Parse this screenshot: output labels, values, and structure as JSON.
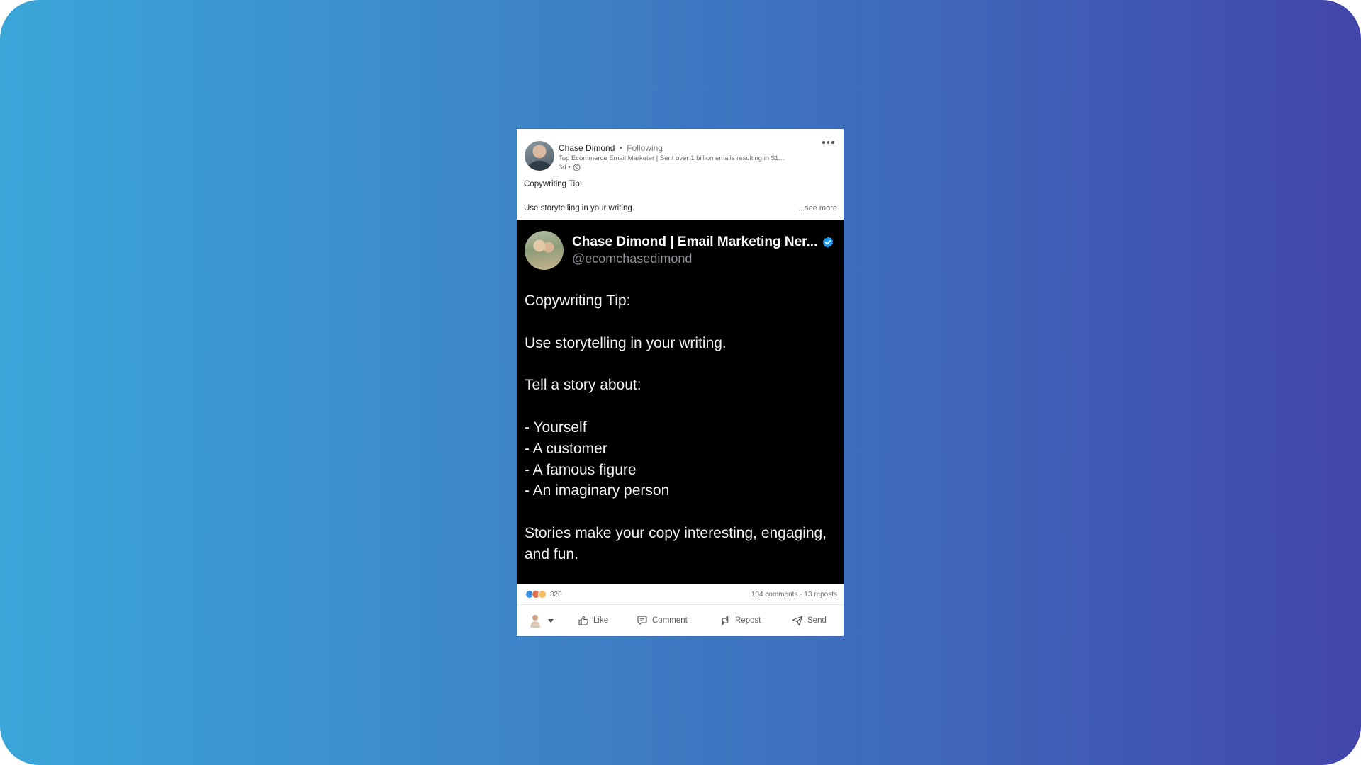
{
  "post": {
    "author_name": "Chase Dimond",
    "separator": "•",
    "follow_status": "Following",
    "headline": "Top Ecommerce Email Marketer | Sent over 1 billion emails resulting in $1...",
    "time": "3d •",
    "body_line1": "Copywriting Tip:",
    "body_line2": "Use storytelling in your writing.",
    "see_more": "...see more"
  },
  "tweet": {
    "name": "Chase Dimond | Email Marketing Ner...",
    "handle": "@ecomchasedimond",
    "lines": [
      "Copywriting Tip:",
      "Use storytelling in your writing.",
      "Tell a story about:",
      "- Yourself",
      "- A customer",
      "- A famous figure",
      "- An imaginary person",
      "Stories make your copy interesting, engaging,",
      "and fun."
    ]
  },
  "stats": {
    "reaction_count": "320",
    "comments_reposts": "104 comments · 13 reposts"
  },
  "actions": {
    "like": "Like",
    "comment": "Comment",
    "repost": "Repost",
    "send": "Send"
  },
  "colors": {
    "background_left": "#3aa6d8",
    "background_right": "#4246a9",
    "verified": "#1d9bf0",
    "like_reaction": "#378fe9"
  },
  "icons": [
    "globe-icon",
    "more-options-icon",
    "verified-icon",
    "like-icon",
    "comment-icon",
    "repost-icon",
    "send-icon"
  ]
}
